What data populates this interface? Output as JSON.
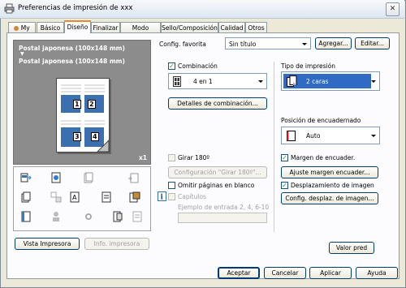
{
  "window": {
    "title": "Preferencias de impresión de xxx",
    "close_label": "✕"
  },
  "tabs": [
    {
      "label": "My Tab"
    },
    {
      "label": "Básico"
    },
    {
      "label": "Diseño"
    },
    {
      "label": "Finalizar"
    },
    {
      "label": "Modo portada"
    },
    {
      "label": "Sello/Composición"
    },
    {
      "label": "Calidad"
    },
    {
      "label": "Otros"
    }
  ],
  "favorites": {
    "label": "Config. favorita",
    "value": "Sin título",
    "add_label": "Agregar...",
    "edit_label": "Editar..."
  },
  "preview": {
    "line1": "Postal japonesa (100x148 mm)",
    "arrow": "▼",
    "line2": "Postal japonesa (100x148 mm)",
    "copies": "x1",
    "page_numbers": [
      "1",
      "2",
      "3",
      "4"
    ]
  },
  "left_buttons": {
    "printer_view": "Vista Impresora",
    "printer_info": "Info. impresora"
  },
  "combination": {
    "label": "Combinación",
    "checked": true,
    "value": "4 en 1",
    "details_label": "Detalles de combinación..."
  },
  "rotate": {
    "label": "Girar 180º",
    "config_label": "Configuración \"Girar 180º\"..."
  },
  "skip_blank": {
    "label": "Omitir páginas en blanco"
  },
  "chapters": {
    "label": "Capítulos",
    "hint": "Ejemplo de entrada 2, 4, 6-10",
    "value": ""
  },
  "print_type": {
    "label": "Tipo de impresión",
    "value": "2 caras"
  },
  "binding": {
    "label": "Posición de encuadernado",
    "value": "Auto"
  },
  "binding_margin": {
    "label": "Margen de encuader.",
    "checked": true,
    "button": "Ajuste margen encuader..."
  },
  "image_shift": {
    "label": "Desplazamiento de imagen",
    "checked": true,
    "button": "Config. desplaz. de imagen..."
  },
  "default_button": "Valor pred",
  "footer": {
    "ok": "Aceptar",
    "cancel": "Cancelar",
    "apply": "Aplicar",
    "help": "Ayuda"
  },
  "colors": {
    "accent": "#2b7fd6",
    "tab_highlight": "#e68b2c",
    "preview_bg": "#8c8c8c",
    "selection": "#316ac5"
  }
}
